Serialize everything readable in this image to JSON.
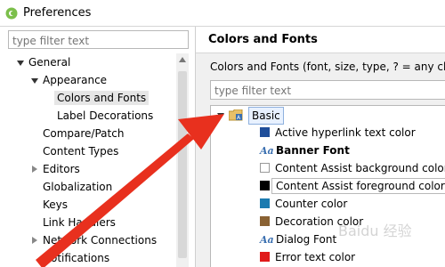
{
  "window": {
    "title": "Preferences",
    "app_icon": "eclipse-icon"
  },
  "left": {
    "filter_placeholder": "type filter text",
    "tree": [
      {
        "label": "General",
        "state": "expanded"
      },
      {
        "label": "Appearance",
        "state": "expanded"
      },
      {
        "label": "Colors and Fonts",
        "state": "leaf",
        "selected": true
      },
      {
        "label": "Label Decorations",
        "state": "leaf"
      },
      {
        "label": "Compare/Patch",
        "state": "leaf"
      },
      {
        "label": "Content Types",
        "state": "leaf"
      },
      {
        "label": "Editors",
        "state": "collapsed"
      },
      {
        "label": "Globalization",
        "state": "leaf"
      },
      {
        "label": "Keys",
        "state": "leaf"
      },
      {
        "label": "Link Handlers",
        "state": "leaf"
      },
      {
        "label": "Network Connections",
        "state": "collapsed"
      },
      {
        "label": "Notifications",
        "state": "leaf"
      }
    ]
  },
  "right": {
    "title": "Colors and Fonts",
    "description": "Colors and Fonts (font, size, type, ? = any cha",
    "filter_placeholder": "type filter text",
    "category": {
      "label": "Basic",
      "icon": "folder-font-icon"
    },
    "items": [
      {
        "kind": "color",
        "label": "Active hyperlink text color",
        "color": "#1f4e9a"
      },
      {
        "kind": "font",
        "label": "Banner Font",
        "bold": true
      },
      {
        "kind": "color",
        "label": "Content Assist background color",
        "color": "#ffffff"
      },
      {
        "kind": "color",
        "label": "Content Assist foreground color",
        "color": "#000000",
        "boxed": true
      },
      {
        "kind": "color",
        "label": "Counter color",
        "color": "#1b7bb0"
      },
      {
        "kind": "color",
        "label": "Decoration color",
        "color": "#8a6233"
      },
      {
        "kind": "font",
        "label": "Dialog Font"
      },
      {
        "kind": "color",
        "label": "Error text color",
        "color": "#e01a1a"
      }
    ]
  },
  "annotation": {
    "arrow_color": "#e8301e"
  },
  "watermark": {
    "text": "Baidu 经验"
  }
}
